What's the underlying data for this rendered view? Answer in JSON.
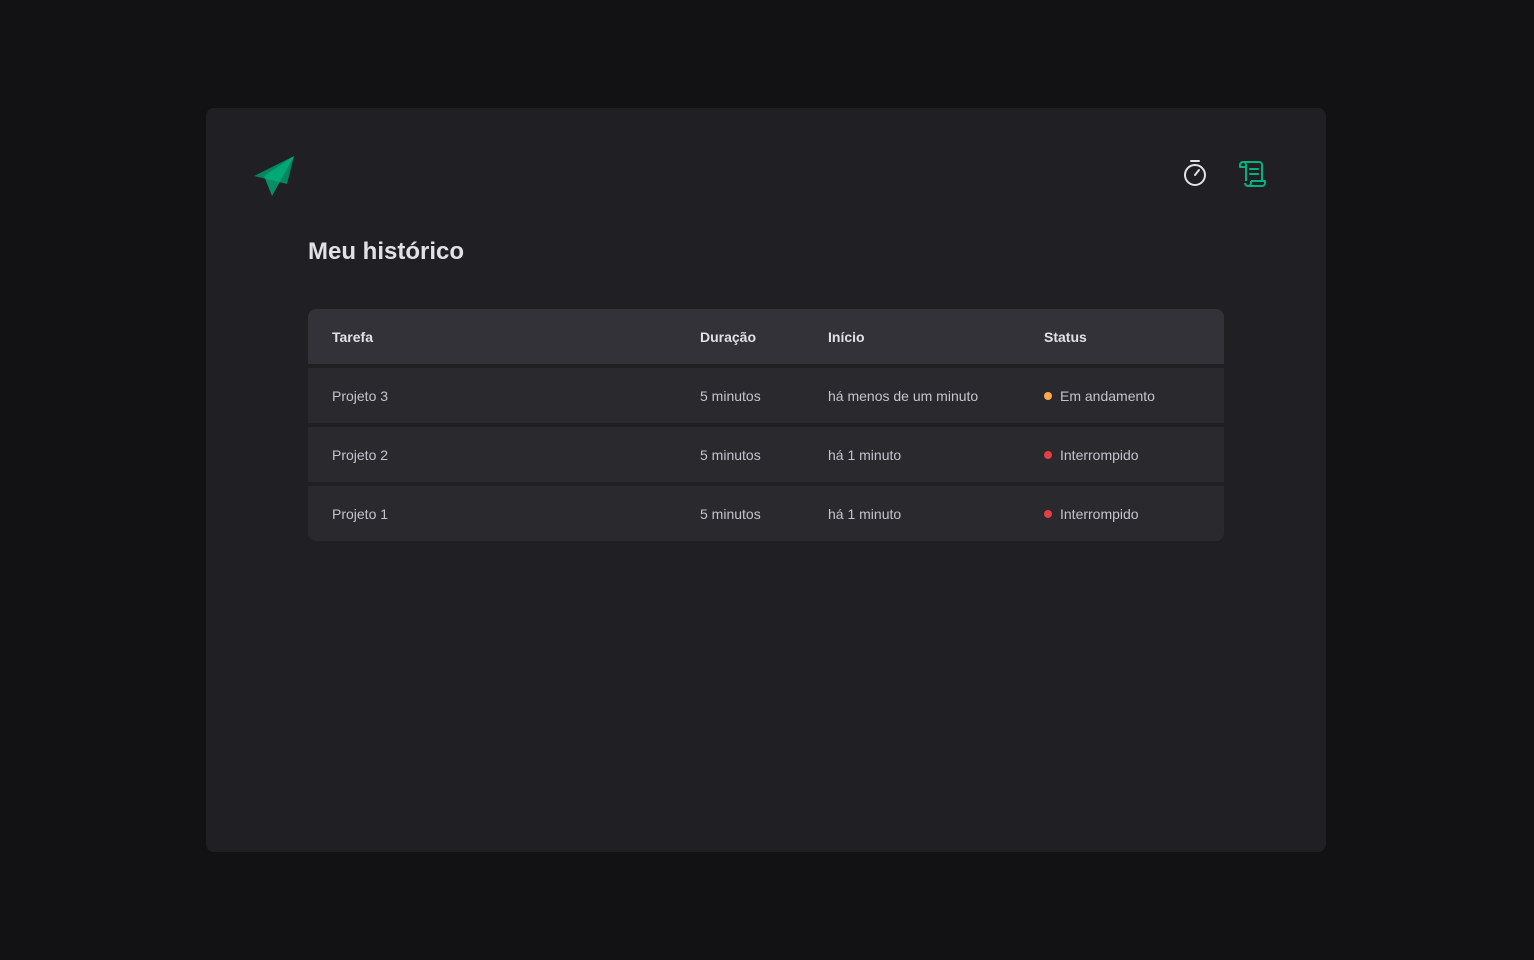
{
  "nav": {
    "timer_icon": "timer-icon",
    "history_icon": "scroll-icon"
  },
  "colors": {
    "brand": "#00875f",
    "brand_light": "#00b37e",
    "in_progress": "#fba94c",
    "interrupted": "#e43f45"
  },
  "page": {
    "title": "Meu histórico"
  },
  "table": {
    "headers": [
      "Tarefa",
      "Duração",
      "Início",
      "Status"
    ],
    "rows": [
      {
        "task": "Projeto 3",
        "duration": "5 minutos",
        "start": "há menos de um minuto",
        "status": "Em andamento",
        "status_color": "#fba94c"
      },
      {
        "task": "Projeto 2",
        "duration": "5 minutos",
        "start": "há 1 minuto",
        "status": "Interrompido",
        "status_color": "#e43f45"
      },
      {
        "task": "Projeto 1",
        "duration": "5 minutos",
        "start": "há 1 minuto",
        "status": "Interrompido",
        "status_color": "#e43f45"
      }
    ]
  }
}
